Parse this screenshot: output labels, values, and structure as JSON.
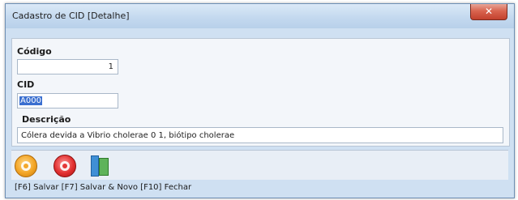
{
  "window": {
    "title": "Cadastro de CID [Detalhe]",
    "close_symbol": "✕"
  },
  "form": {
    "codigo": {
      "label": "Código",
      "value": "1"
    },
    "cid": {
      "label": "CID",
      "value": "A000"
    },
    "descricao": {
      "label": "Descrição",
      "value": "Cólera devida a Vibrio cholerae 0 1, biótipo cholerae"
    }
  },
  "toolbar": {
    "icons": [
      "save-icon",
      "save-new-icon",
      "close-door-icon"
    ]
  },
  "statusbar": {
    "text": "[F6] Salvar [F7] Salvar & Novo [F10] Fechar"
  }
}
